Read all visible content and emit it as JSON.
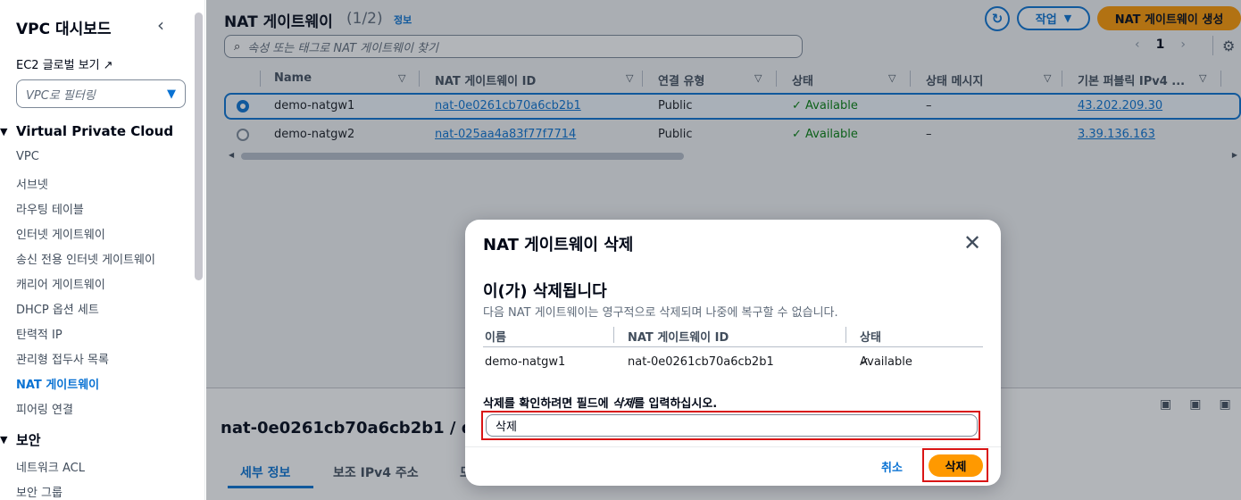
{
  "sidebar": {
    "title": "VPC 대시보드",
    "ec2_link": "EC2 글로벌 보기",
    "filter_placeholder": "VPC로 필터링",
    "section_vpc": "Virtual Private Cloud",
    "items": [
      "VPC",
      "서브넷",
      "라우팅 테이블",
      "인터넷 게이트웨이",
      "송신 전용 인터넷 게이트웨이",
      "캐리어 게이트웨이",
      "DHCP 옵션 세트",
      "탄력적 IP",
      "관리형 접두사 목록",
      "NAT 게이트웨이",
      "피어링 연결"
    ],
    "active_item": "NAT 게이트웨이",
    "section_security": "보안",
    "security_items": [
      "네트워크 ACL",
      "보안 그룹"
    ]
  },
  "header": {
    "title": "NAT 게이트웨이",
    "count": "(1/2)",
    "info": "정보",
    "actions_label": "작업",
    "create_label": "NAT 게이트웨이 생성",
    "search_placeholder": "속성 또는 태그로 NAT 게이트웨이 찾기",
    "page_number": "1"
  },
  "table": {
    "columns": [
      "Name",
      "NAT 게이트웨이 ID",
      "연결 유형",
      "상태",
      "상태 메시지",
      "기본 퍼블릭 IPv4 ..."
    ],
    "rows": [
      {
        "name": "demo-natgw1",
        "id": "nat-0e0261cb70a6cb2b1",
        "type": "Public",
        "status": "Available",
        "message": "–",
        "ip": "43.202.209.30",
        "selected": true
      },
      {
        "name": "demo-natgw2",
        "id": "nat-025aa4a83f77f7714",
        "type": "Public",
        "status": "Available",
        "message": "–",
        "ip": "3.39.136.163",
        "selected": false
      }
    ]
  },
  "details": {
    "title": "nat-0e0261cb70a6cb2b1 / dem",
    "tabs": [
      "세부 정보",
      "보조 IPv4 주소",
      "모"
    ]
  },
  "modal": {
    "title": "NAT 게이트웨이 삭제",
    "warning_title": "이(가) 삭제됩니다",
    "warning_desc": "다음 NAT 게이트웨이는 영구적으로 삭제되며 나중에 복구할 수 없습니다.",
    "columns": [
      "이름",
      "NAT 게이트웨이 ID",
      "상태"
    ],
    "row": {
      "name": "demo-natgw1",
      "id": "nat-0e0261cb70a6cb2b1",
      "status": "Available"
    },
    "confirm_prefix": "삭제를 확인하려면 필드에 ",
    "confirm_keyword": "삭제",
    "confirm_suffix": "를 입력하십시오.",
    "input_value": "삭제",
    "cancel_label": "취소",
    "delete_label": "삭제"
  },
  "colors": {
    "accent": "#0972d3",
    "primary_button": "#ff9900",
    "success": "#037f0c",
    "highlight": "#d91515"
  }
}
